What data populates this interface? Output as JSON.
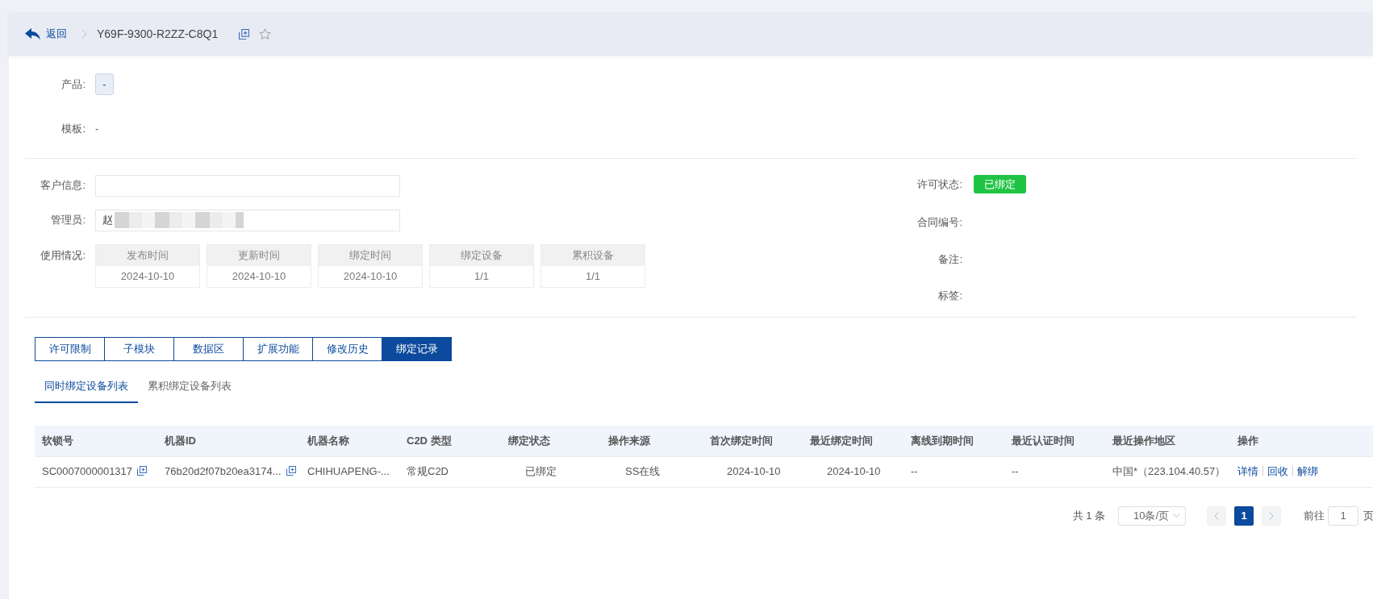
{
  "header": {
    "back": "返回",
    "title": "Y69F-9300-R2ZZ-C8Q1",
    "starred": false
  },
  "product": {
    "label": "产品:",
    "value": "-"
  },
  "template": {
    "label": "模板:",
    "value": "-"
  },
  "customer": {
    "label": "客户信息:"
  },
  "admin": {
    "label": "管理员:",
    "value": "赵"
  },
  "usage": {
    "label": "使用情况:",
    "items": [
      {
        "name": "发布时间",
        "value": "2024-10-10"
      },
      {
        "name": "更新时间",
        "value": "2024-10-10"
      },
      {
        "name": "绑定时间",
        "value": "2024-10-10"
      },
      {
        "name": "绑定设备",
        "value": "1/1"
      },
      {
        "name": "累积设备",
        "value": "1/1"
      }
    ]
  },
  "right_fields": [
    {
      "label": "许可状态:",
      "kind": "badge",
      "value": "已绑定",
      "color": "#1fc444"
    },
    {
      "label": "合同编号:",
      "kind": "text"
    },
    {
      "label": "备注:",
      "kind": "text"
    },
    {
      "label": "标签:",
      "kind": "text"
    }
  ],
  "tabs": [
    {
      "label": "许可限制",
      "selected": false
    },
    {
      "label": "子模块",
      "selected": false
    },
    {
      "label": "数据区",
      "selected": false
    },
    {
      "label": "扩展功能",
      "selected": false
    },
    {
      "label": "修改历史",
      "selected": false
    },
    {
      "label": "绑定记录",
      "selected": true
    }
  ],
  "subtabs": [
    {
      "label": "同时绑定设备列表",
      "selected": true
    },
    {
      "label": "累积绑定设备列表",
      "selected": false
    }
  ],
  "table": {
    "columns": [
      "软锁号",
      "机器ID",
      "机器名称",
      "C2D 类型",
      "绑定状态",
      "操作来源",
      "首次绑定时间",
      "最近绑定时间",
      "离线到期时间",
      "最近认证时间",
      "最近操作地区",
      "操作"
    ],
    "rows": [
      [
        {
          "kind": "copy",
          "text": "SC0007000001317"
        },
        {
          "kind": "copy",
          "text": "76b20d2f07b20ea3174..."
        },
        {
          "kind": "text",
          "text": "CHIHUAPENG-..."
        },
        {
          "kind": "text",
          "text": "常规C2D"
        },
        {
          "kind": "text",
          "text": "已绑定"
        },
        {
          "kind": "text",
          "text": "SS在线"
        },
        {
          "kind": "text",
          "text": "2024-10-10"
        },
        {
          "kind": "text",
          "text": "2024-10-10"
        },
        {
          "kind": "text",
          "text": "--"
        },
        {
          "kind": "text",
          "text": "--"
        },
        {
          "kind": "text",
          "text": "中国*（223.104.40.57）"
        },
        {
          "kind": "actions",
          "links": [
            "详情",
            "回收",
            "解绑"
          ]
        }
      ]
    ]
  },
  "pagination": {
    "total": "共 1 条",
    "page_size": "10条/页",
    "pages": [
      {
        "label": "1",
        "selected": true
      }
    ],
    "goto_label": "前往",
    "goto_value": "1",
    "goto_suffix": "页"
  }
}
